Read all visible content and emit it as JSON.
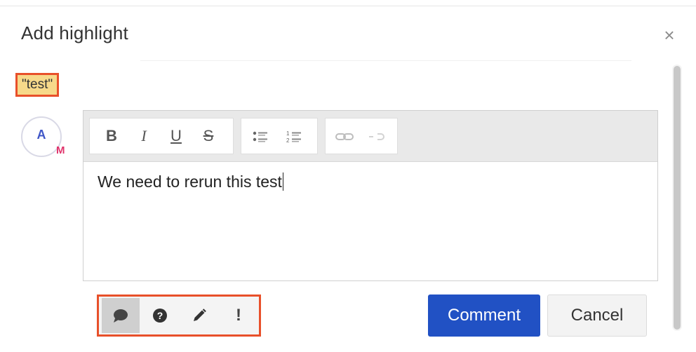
{
  "dialog": {
    "title": "Add highlight",
    "close_icon": "close-icon",
    "close_glyph": "×"
  },
  "highlight": {
    "quote": "\"test\""
  },
  "user": {
    "avatar_letter": "A",
    "badge_letter": "M"
  },
  "editor": {
    "toolbar": {
      "bold": "B",
      "italic": "I",
      "underline": "U",
      "strike": "S",
      "icons": [
        "bullet-list-icon",
        "numbered-list-icon",
        "link-icon",
        "unlink-icon"
      ]
    },
    "value": "We need to rerun this test"
  },
  "comment_types": [
    {
      "icon": "comment-bubble-icon",
      "active": true
    },
    {
      "icon": "question-icon",
      "active": false
    },
    {
      "icon": "pencil-icon",
      "active": false
    },
    {
      "icon": "exclamation-icon",
      "label": "!",
      "active": false
    }
  ],
  "actions": {
    "submit_label": "Comment",
    "cancel_label": "Cancel"
  },
  "colors": {
    "accent_blue": "#2151c4",
    "highlight_fill": "#f7d98a",
    "annotation_red": "#e8502a",
    "avatar_letter": "#3f56c7",
    "badge": "#e0336b"
  }
}
